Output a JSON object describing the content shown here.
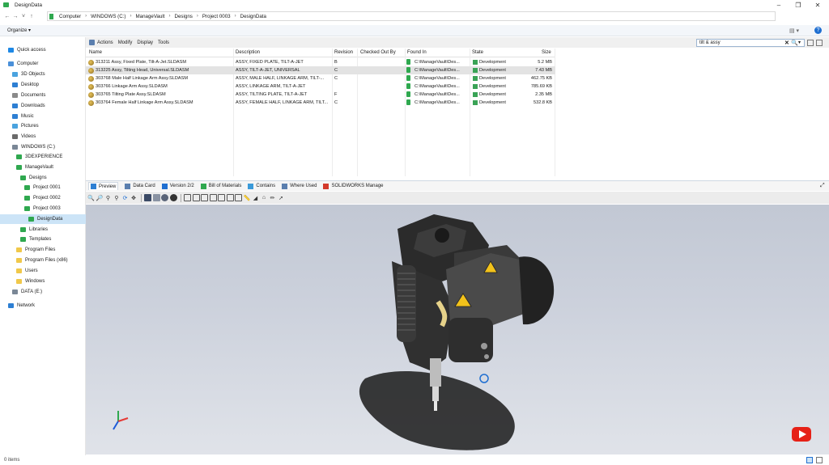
{
  "window": {
    "title": "DesignData"
  },
  "address": {
    "crumbs": [
      "Computer",
      "WINDOWS (C:)",
      "ManageVault",
      "Designs",
      "Project 0003",
      "DesignData"
    ]
  },
  "organize": {
    "label": "Organize ▾"
  },
  "sidebar": {
    "items": [
      {
        "label": "Quick access",
        "icon": "star-icon",
        "color": "#1e88e5",
        "indent": 0,
        "selected": false
      },
      {
        "label": "Computer",
        "icon": "computer-icon",
        "color": "#4a90d9",
        "indent": 0,
        "selected": false
      },
      {
        "label": "3D Objects",
        "icon": "cube-icon",
        "color": "#4aa3df",
        "indent": 1,
        "selected": false
      },
      {
        "label": "Desktop",
        "icon": "desktop-icon",
        "color": "#2d7fd3",
        "indent": 1,
        "selected": false
      },
      {
        "label": "Documents",
        "icon": "document-icon",
        "color": "#8a8a8a",
        "indent": 1,
        "selected": false
      },
      {
        "label": "Downloads",
        "icon": "download-icon",
        "color": "#2d7fd3",
        "indent": 1,
        "selected": false
      },
      {
        "label": "Music",
        "icon": "music-icon",
        "color": "#2d7fd3",
        "indent": 1,
        "selected": false
      },
      {
        "label": "Pictures",
        "icon": "picture-icon",
        "color": "#4aa3df",
        "indent": 1,
        "selected": false
      },
      {
        "label": "Videos",
        "icon": "video-icon",
        "color": "#6a6a6a",
        "indent": 1,
        "selected": false
      },
      {
        "label": "WINDOWS (C:)",
        "icon": "drive-icon",
        "color": "#7a8796",
        "indent": 1,
        "selected": false
      },
      {
        "label": "3DEXPERIENCE",
        "icon": "vault-icon",
        "color": "#2fa84f",
        "indent": 2,
        "selected": false
      },
      {
        "label": "ManageVault",
        "icon": "vault-icon",
        "color": "#2fa84f",
        "indent": 2,
        "selected": false
      },
      {
        "label": "Designs",
        "icon": "folder-green-icon",
        "color": "#2fa84f",
        "indent": 3,
        "selected": false
      },
      {
        "label": "Project 0001",
        "icon": "folder-green-icon",
        "color": "#2fa84f",
        "indent": 4,
        "selected": false
      },
      {
        "label": "Project 0002",
        "icon": "folder-green-icon",
        "color": "#2fa84f",
        "indent": 4,
        "selected": false
      },
      {
        "label": "Project 0003",
        "icon": "folder-green-icon",
        "color": "#2fa84f",
        "indent": 4,
        "selected": false
      },
      {
        "label": "DesignData",
        "icon": "folder-green-icon",
        "color": "#2fa84f",
        "indent": 5,
        "selected": true
      },
      {
        "label": "Libraries",
        "icon": "folder-green-icon",
        "color": "#2fa84f",
        "indent": 3,
        "selected": false
      },
      {
        "label": "Templates",
        "icon": "folder-green-icon",
        "color": "#2fa84f",
        "indent": 3,
        "selected": false
      },
      {
        "label": "Program Files",
        "icon": "folder-icon",
        "color": "#f0c84a",
        "indent": 2,
        "selected": false
      },
      {
        "label": "Program Files (x86)",
        "icon": "folder-icon",
        "color": "#f0c84a",
        "indent": 2,
        "selected": false
      },
      {
        "label": "Users",
        "icon": "folder-icon",
        "color": "#f0c84a",
        "indent": 2,
        "selected": false
      },
      {
        "label": "Windows",
        "icon": "folder-icon",
        "color": "#f0c84a",
        "indent": 2,
        "selected": false
      },
      {
        "label": "DATA (E:)",
        "icon": "drive-icon",
        "color": "#7a8796",
        "indent": 1,
        "selected": false
      },
      {
        "label": "Network",
        "icon": "network-icon",
        "color": "#2d7fd3",
        "indent": 0,
        "selected": false
      }
    ]
  },
  "commands": [
    "Actions",
    "Modify",
    "Display",
    "Tools"
  ],
  "search": {
    "value": "tilt & assy"
  },
  "columns": [
    "Name",
    "Description",
    "Revision",
    "Checked Out By",
    "Found In",
    "State",
    "Size"
  ],
  "files": [
    {
      "name": "313211 Assy, Fixed Plate, Tilt-A-Jet.SLDASM",
      "desc": "ASSY, FIXED PLATE, TILT-A-JET",
      "rev": "B",
      "found": "C:\\ManageVault\\Des...",
      "state": "Development",
      "size": "5.2 MB",
      "selected": false
    },
    {
      "name": "313225 Assy, Tilting Head, Universal.SLDASM",
      "desc": "ASSY, TILT-A-JET, UNIVERSAL",
      "rev": "C",
      "found": "C:\\ManageVault\\Des...",
      "state": "Development",
      "size": "7.43 MB",
      "selected": true
    },
    {
      "name": "303768 Male Half Linkage Arm Assy.SLDASM",
      "desc": "ASSY, MALE HALF, LINKAGE ARM, TILT-...",
      "rev": "C",
      "found": "C:\\ManageVault\\Des...",
      "state": "Development",
      "size": "462.75 KB",
      "selected": false
    },
    {
      "name": "303766 Linkage Arm Assy.SLDASM",
      "desc": "ASSY, LINKAGE ARM, TILT-A-JET",
      "rev": "",
      "found": "C:\\ManageVault\\Des...",
      "state": "Development",
      "size": "785.69 KB",
      "selected": false
    },
    {
      "name": "303765 Tilting Plate Assy.SLDASM",
      "desc": "ASSY, TILTING PLATE, TILT-A-JET",
      "rev": "F",
      "found": "C:\\ManageVault\\Des...",
      "state": "Development",
      "size": "2.35 MB",
      "selected": false
    },
    {
      "name": "303764 Female Half Linkage Arm Assy.SLDASM",
      "desc": "ASSY, FEMALE HALF, LINKAGE ARM, TILT...",
      "rev": "C",
      "found": "C:\\ManageVault\\Des...",
      "state": "Development",
      "size": "532.8 KB",
      "selected": false
    }
  ],
  "tabs": [
    {
      "label": "Preview",
      "icon": "preview-icon",
      "active": true
    },
    {
      "label": "Data Card",
      "icon": "data-card-icon",
      "active": false
    },
    {
      "label": "Version 2/2",
      "icon": "version-icon",
      "active": false
    },
    {
      "label": "Bill of Materials",
      "icon": "bom-icon",
      "active": false
    },
    {
      "label": "Contains",
      "icon": "contains-icon",
      "active": false
    },
    {
      "label": "Where Used",
      "icon": "where-used-icon",
      "active": false
    },
    {
      "label": "SOLIDWORKS Manage",
      "icon": "manage-icon",
      "active": false
    }
  ],
  "status": {
    "items": "0 items"
  },
  "colors": {
    "accent": "#cce4f7",
    "vault_green": "#2fa84f",
    "viewport_top": "#c2c8d4",
    "youtube_red": "#e62117"
  }
}
